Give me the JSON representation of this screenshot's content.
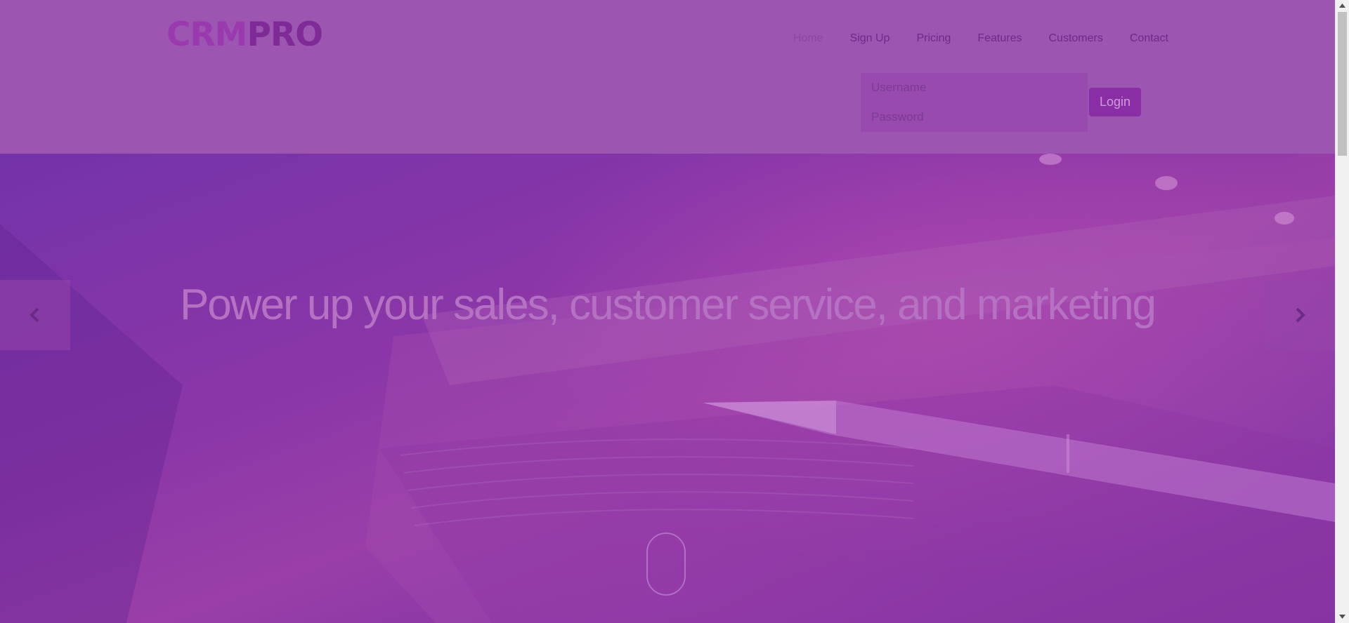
{
  "header": {
    "logo": {
      "part1": "CRM",
      "part2": "PRO"
    },
    "nav": {
      "home": "Home",
      "sign_up": "Sign Up",
      "pricing": "Pricing",
      "features": "Features",
      "customers": "Customers",
      "contact": "Contact"
    },
    "login": {
      "username_placeholder": "Username",
      "password_placeholder": "Password",
      "button_label": "Login"
    }
  },
  "hero": {
    "headline": "Power up your sales, customer service, and marketing",
    "prev_icon": "chevron-left-icon",
    "next_icon": "chevron-right-icon"
  },
  "colors": {
    "header_bg": "#9c55b1",
    "accent": "#8a2ea6",
    "hero_text": "#b572c2"
  }
}
